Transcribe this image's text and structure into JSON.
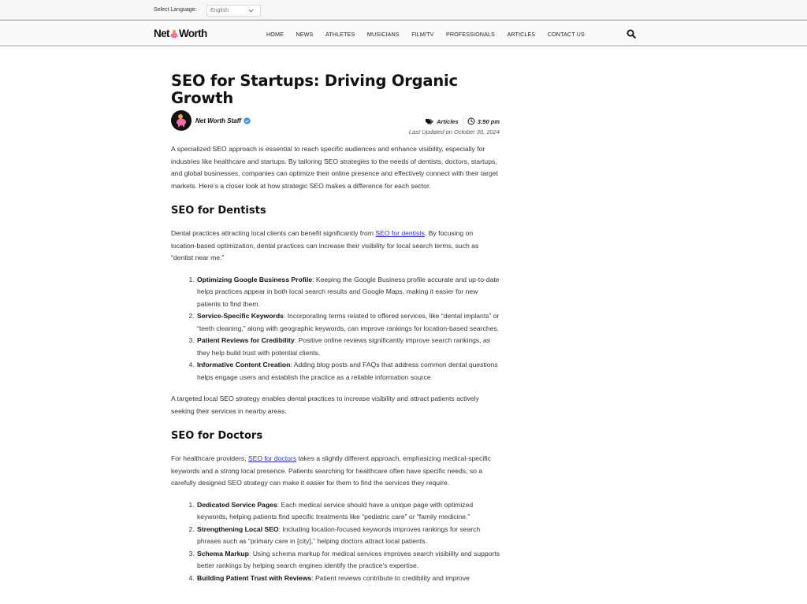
{
  "topbar": {
    "language_label": "Select Language:",
    "language_selected": "English"
  },
  "navbar": {
    "logo_left": "Net",
    "logo_right": "Worth",
    "links": [
      "HOME",
      "NEWS",
      "ATHLETES",
      "MUSICIANS",
      "FILM/TV",
      "PROFESSIONALS",
      "ARTICLES",
      "CONTACT US"
    ],
    "search_icon": "search-icon"
  },
  "article": {
    "title": "SEO for Startups: Driving Organic Growth",
    "author": "Net Worth Staff",
    "category": "Articles",
    "time": "3:50 pm",
    "last_updated": "Last Updated on October 30, 2024",
    "intro": "A specialized SEO approach is essential to reach specific audiences and enhance visibility, especially for industries like healthcare and startups. By tailoring SEO strategies to the needs of dentists, doctors, startups, and global businesses, companies can optimize their online presence and effectively connect with their target markets. Here’s a closer look at how strategic SEO makes a difference for each sector.",
    "sections": [
      {
        "heading": "SEO for Dentists",
        "para_before": "Dental practices attracting local clients can benefit significantly from ",
        "link_text": "SEO for dentists",
        "para_after": ". By focusing on location-based optimization, dental practices can increase their visibility for local search terms, such as “dentist near me.”",
        "items": [
          {
            "title": "Optimizing Google Business Profile",
            "text": ": Keeping the Google Business profile accurate and up-to-date helps practices appear in both local search results and Google Maps, making it easier for new patients to find them."
          },
          {
            "title": "Service-Specific Keywords",
            "text": ": Incorporating terms related to offered services, like “dental implants” or “teeth cleaning,” along with geographic keywords, can improve rankings for location-based searches."
          },
          {
            "title": "Patient Reviews for Credibility",
            "text": ": Positive online reviews significantly improve search rankings, as they help build trust with potential clients."
          },
          {
            "title": "Informative Content Creation",
            "text": ": Adding blog posts and FAQs that address common dental questions helps engage users and establish the practice as a reliable information source."
          }
        ],
        "closing": "A targeted local SEO strategy enables dental practices to increase visibility and attract patients actively seeking their services in nearby areas."
      },
      {
        "heading": "SEO for Doctors",
        "para_before": "For healthcare providers, ",
        "link_text": "SEO for doctors",
        "para_after": " takes a slightly different approach, emphasizing medical-specific keywords and a strong local presence. Patients searching for healthcare often have specific needs, so a carefully designed SEO strategy can make it easier for them to find the services they require.",
        "items": [
          {
            "title": "Dedicated Service Pages",
            "text": ": Each medical service should have a unique page with optimized keywords, helping patients find specific treatments like “pediatric care” or “family medicine.”"
          },
          {
            "title": "Strengthening Local SEO",
            "text": ": Including location-focused keywords improves rankings for search phrases such as “primary care in [city],” helping doctors attract local patients."
          },
          {
            "title": "Schema Markup",
            "text": ": Using schema markup for medical services improves search visibility and supports better rankings by helping search engines identify the practice’s expertise."
          },
          {
            "title": "Building Patient Trust with Reviews",
            "text": ": Patient reviews contribute to credibility and improve"
          }
        ]
      }
    ]
  }
}
